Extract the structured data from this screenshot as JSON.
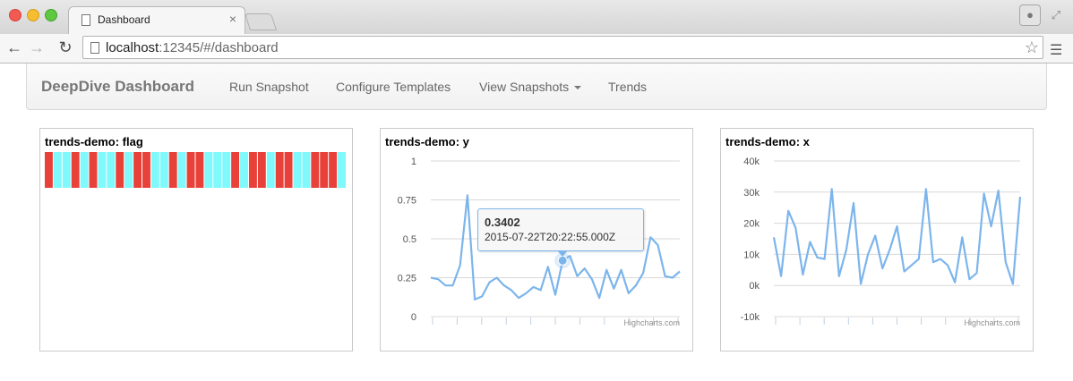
{
  "browser": {
    "tab_title": "Dashboard",
    "tab_close": "×",
    "url_host": "localhost",
    "url_rest": ":12345/#/dashboard"
  },
  "navbar": {
    "brand": "DeepDive Dashboard",
    "items": [
      "Run Snapshot",
      "Configure Templates",
      "View Snapshots",
      "Trends"
    ]
  },
  "colors": {
    "flag_true": "#e8413a",
    "flag_false": "#7ff9fb",
    "series": "#7cb5ec"
  },
  "panels": [
    {
      "title": "trends-demo: flag",
      "chart_data": {
        "type": "heatmap",
        "values": [
          1,
          0,
          0,
          1,
          0,
          1,
          0,
          0,
          1,
          0,
          1,
          1,
          0,
          0,
          1,
          0,
          1,
          1,
          0,
          0,
          0,
          1,
          0,
          1,
          1,
          0,
          1,
          1,
          0,
          0,
          1,
          1,
          1,
          0
        ]
      }
    },
    {
      "title": "trends-demo: y",
      "credits": "Highcharts.com",
      "tooltip": {
        "value": "0.3402",
        "timestamp": "2015-07-22T20:22:55.000Z"
      },
      "chart_data": {
        "type": "line",
        "ylim": [
          0,
          1
        ],
        "yticks": [
          "0",
          "0.25",
          "0.5",
          "0.75",
          "1"
        ],
        "yticks_values": [
          0,
          0.25,
          0.5,
          0.75,
          1
        ],
        "values": [
          0.25,
          0.24,
          0.2,
          0.2,
          0.33,
          0.78,
          0.11,
          0.13,
          0.22,
          0.25,
          0.2,
          0.17,
          0.12,
          0.15,
          0.19,
          0.17,
          0.32,
          0.14,
          0.36,
          0.39,
          0.26,
          0.31,
          0.24,
          0.12,
          0.3,
          0.18,
          0.3,
          0.15,
          0.2,
          0.28,
          0.51,
          0.46,
          0.26,
          0.25,
          0.29
        ],
        "highlight_index": 18
      }
    },
    {
      "title": "trends-demo: x",
      "credits": "Highcharts.com",
      "chart_data": {
        "type": "line",
        "ylim": [
          -10000,
          40000
        ],
        "yticks": [
          "-10k",
          "0k",
          "10k",
          "20k",
          "30k",
          "40k"
        ],
        "yticks_values": [
          -10000,
          0,
          10000,
          20000,
          30000,
          40000
        ],
        "values": [
          15500,
          3000,
          24000,
          18500,
          3500,
          14000,
          9000,
          8500,
          31000,
          3000,
          11500,
          26500,
          500,
          10000,
          16000,
          5500,
          11500,
          19000,
          4500,
          6500,
          8500,
          31000,
          7500,
          8500,
          6500,
          1000,
          15500,
          2000,
          4000,
          29500,
          19000,
          30500,
          7500,
          500,
          28500
        ]
      }
    }
  ]
}
